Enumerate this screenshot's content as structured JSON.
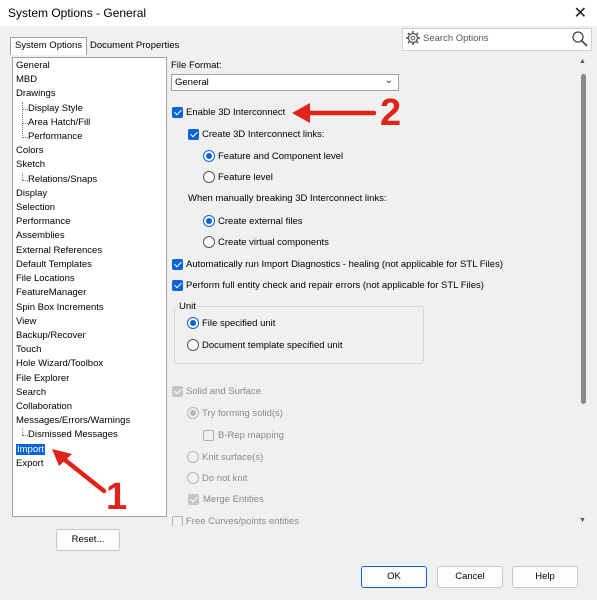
{
  "window": {
    "title": "System Options - General"
  },
  "tabs": [
    {
      "label": "System Options"
    },
    {
      "label": "Document Properties"
    }
  ],
  "search": {
    "placeholder": "Search Options"
  },
  "tree": {
    "items": [
      {
        "label": "General"
      },
      {
        "label": "MBD"
      },
      {
        "label": "Drawings"
      },
      {
        "label": "Display Style"
      },
      {
        "label": "Area Hatch/Fill"
      },
      {
        "label": "Performance"
      },
      {
        "label": "Colors"
      },
      {
        "label": "Sketch"
      },
      {
        "label": "Relations/Snaps"
      },
      {
        "label": "Display"
      },
      {
        "label": "Selection"
      },
      {
        "label": "Performance"
      },
      {
        "label": "Assemblies"
      },
      {
        "label": "External References"
      },
      {
        "label": "Default Templates"
      },
      {
        "label": "File Locations"
      },
      {
        "label": "FeatureManager"
      },
      {
        "label": "Spin Box Increments"
      },
      {
        "label": "View"
      },
      {
        "label": "Backup/Recover"
      },
      {
        "label": "Touch"
      },
      {
        "label": "Hole Wizard/Toolbox"
      },
      {
        "label": "File Explorer"
      },
      {
        "label": "Search"
      },
      {
        "label": "Collaboration"
      },
      {
        "label": "Messages/Errors/Warnings"
      },
      {
        "label": "Dismissed Messages"
      },
      {
        "label": "Import"
      },
      {
        "label": "Export"
      }
    ],
    "selected": "Import"
  },
  "reset_label": "Reset...",
  "options": {
    "file_format_label": "File Format:",
    "file_format_value": "General",
    "enable_3d_interconnect": "Enable 3D Interconnect",
    "create_links": "Create 3D Interconnect links:",
    "feature_component_level": "Feature and Component level",
    "feature_level": "Feature level",
    "breaking_links": "When manually breaking 3D Interconnect links:",
    "create_external_files": "Create external files",
    "create_virtual_components": "Create virtual components",
    "auto_import_diagnostics": "Automatically run Import Diagnostics - healing (not applicable for STL Files)",
    "full_entity_check": "Perform full entity check and repair errors (not applicable for STL Files)",
    "unit_group": "Unit",
    "file_specified_unit": "File specified unit",
    "document_template_unit": "Document template specified unit",
    "solid_and_surface": "Solid and Surface",
    "try_forming_solids": "Try forming solid(s)",
    "brep_mapping": "B-Rep mapping",
    "knit_surfaces": "Knit surface(s)",
    "do_not_knit": "Do not knit",
    "merge_entities": "Merge Entities",
    "free_curves": "Free Curves/points entities"
  },
  "buttons": {
    "ok": "OK",
    "cancel": "Cancel",
    "help": "Help"
  },
  "annotations": {
    "one": "1",
    "two": "2"
  },
  "colors": {
    "accent": "#0a64d8",
    "annotation": "#e2231a"
  }
}
